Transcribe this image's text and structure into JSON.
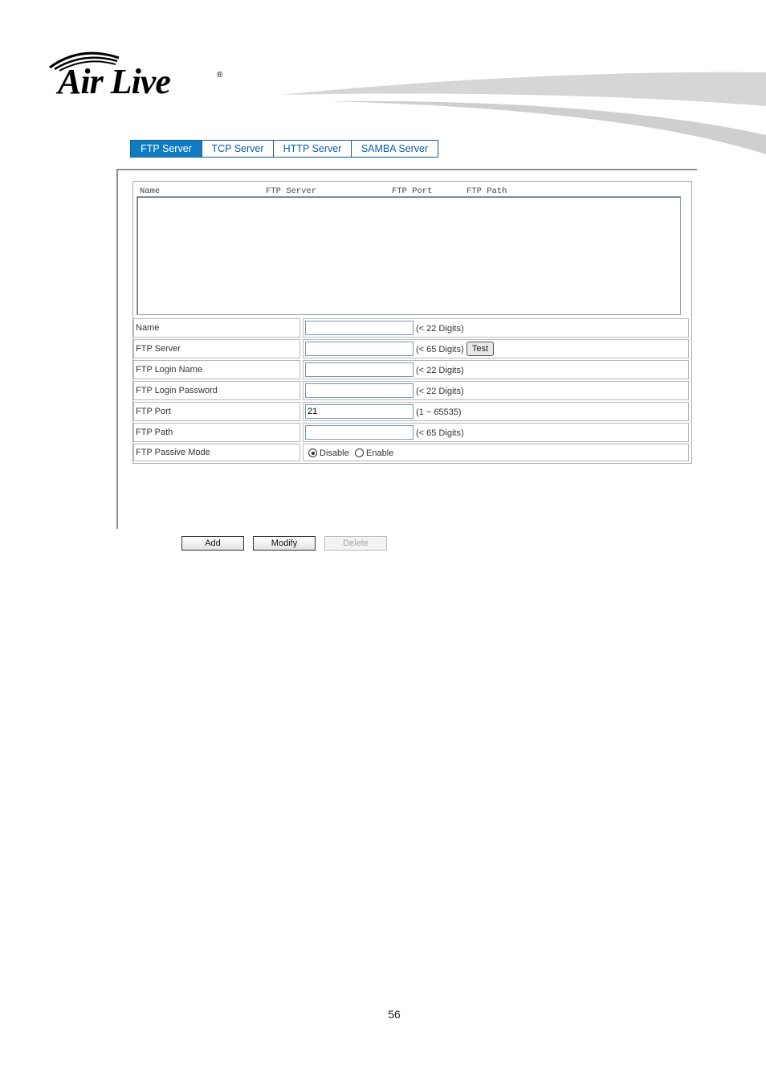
{
  "brand": {
    "logo_text": "Air Live",
    "registered_mark": "®"
  },
  "tabs": [
    {
      "label": "FTP Server",
      "active": true
    },
    {
      "label": "TCP Server",
      "active": false
    },
    {
      "label": "HTTP Server",
      "active": false
    },
    {
      "label": "SAMBA Server",
      "active": false
    }
  ],
  "list": {
    "columns": [
      "Name",
      "FTP Server",
      "FTP Port",
      "FTP Path"
    ],
    "rows": []
  },
  "form": {
    "name": {
      "label": "Name",
      "value": "",
      "hint": "(< 22 Digits)"
    },
    "ftp_server": {
      "label": "FTP Server",
      "value": "",
      "hint": "(< 65 Digits)",
      "test_label": "Test"
    },
    "login_name": {
      "label": "FTP Login Name",
      "value": "",
      "hint": "(< 22 Digits)"
    },
    "login_password": {
      "label": "FTP Login Password",
      "value": "",
      "hint": "(< 22 Digits)"
    },
    "port": {
      "label": "FTP Port",
      "value": "21",
      "hint": "(1 ~ 65535)"
    },
    "path": {
      "label": "FTP Path",
      "value": "",
      "hint": "(< 65 Digits)"
    },
    "passive_mode": {
      "label": "FTP Passive Mode",
      "options": [
        "Disable",
        "Enable"
      ],
      "selected": "Disable"
    }
  },
  "actions": {
    "add": "Add",
    "modify": "Modify",
    "delete": "Delete"
  },
  "page_number": "56",
  "colors": {
    "tab_active_bg": "#0f7cc4",
    "tab_text": "#0b5fa8",
    "swoosh": "#d8d8d8"
  }
}
